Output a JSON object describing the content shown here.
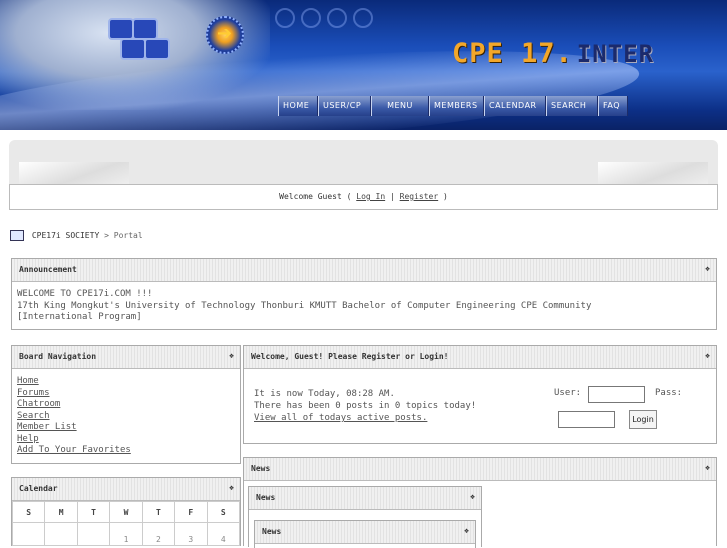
{
  "header": {
    "logo_main": "CPE 17.",
    "logo_sub": "INTER",
    "nav": [
      "HOME",
      "USER/CP",
      "MENU",
      "MEMBERS",
      "CALENDAR",
      "SEARCH",
      "FAQ"
    ]
  },
  "welcome": {
    "prefix": "Welcome Guest (",
    "login": "Log In",
    "sep": "|",
    "register": "Register",
    "suffix": ")"
  },
  "breadcrumb": {
    "site": "CPE17i SOCIETY",
    "sep": ">",
    "page": "Portal"
  },
  "announcement": {
    "title": "Announcement",
    "lines": [
      "WELCOME TO CPE17i.COM !!!",
      "17th King Mongkut's University of Technology Thonburi KMUTT Bachelor of Computer Engineering CPE Community",
      "[International Program]"
    ]
  },
  "board_nav": {
    "title": "Board Navigation",
    "links": [
      "Home",
      "Forums",
      "Chatroom",
      "Search",
      "Member List",
      "Help",
      "Add To Your Favorites"
    ]
  },
  "calendar": {
    "title": "Calendar",
    "days": [
      "S",
      "M",
      "T",
      "W",
      "T",
      "F",
      "S"
    ],
    "first_week": [
      "",
      "",
      "",
      "1",
      "2",
      "3",
      "4"
    ]
  },
  "guest_panel": {
    "title": "Welcome, Guest! Please Register or Login!",
    "line1": "It is now Today, 08:28 AM.",
    "line2": "There has been 0 posts in 0 topics today!",
    "link": "View all of todays active posts.",
    "user_label": "User:",
    "pass_label": "Pass:",
    "login_button": "Login"
  },
  "news": {
    "title": "News",
    "inner_title": "News",
    "inner2_title": "News"
  },
  "toggle_glyph": "❖",
  "colors": {
    "accent": "#1a4db8",
    "logo": "#f3a72a"
  }
}
